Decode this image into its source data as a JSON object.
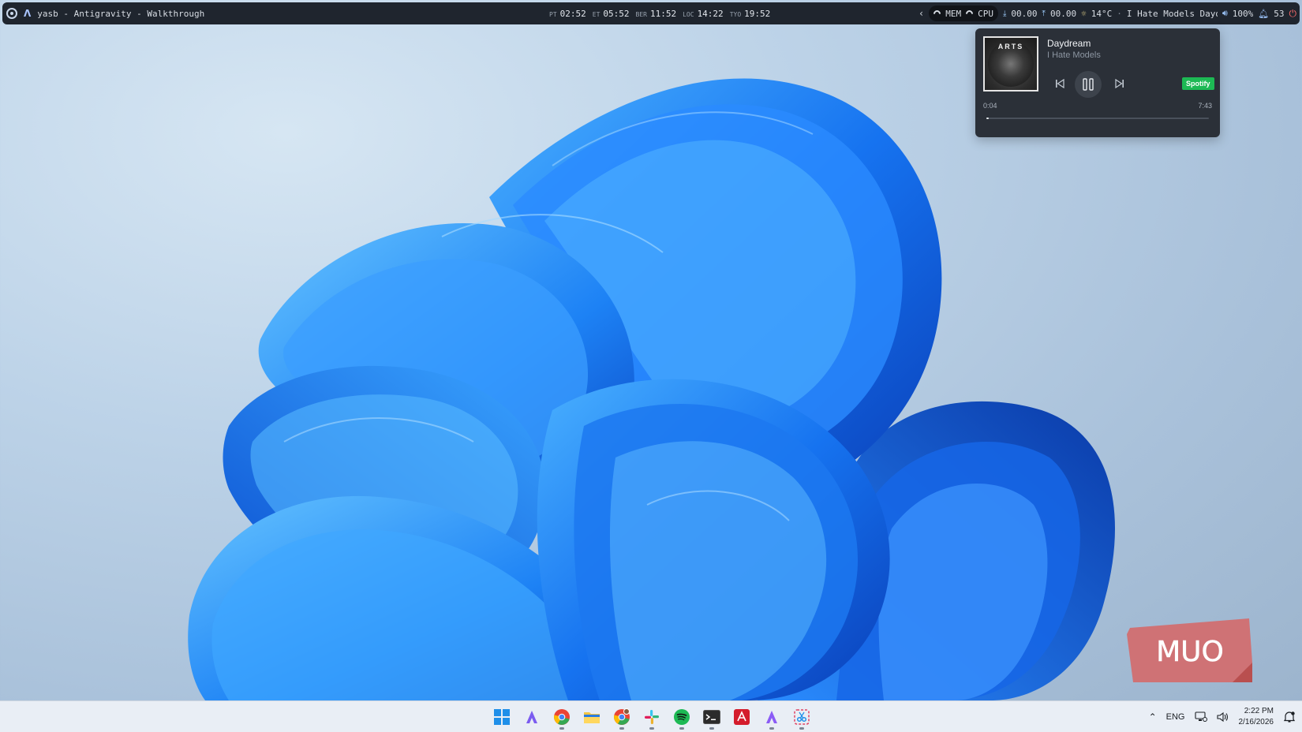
{
  "topbar": {
    "window_title": "yasb - Antigravity - Walkthrough",
    "clocks": [
      {
        "label": "PT",
        "time": "02:52"
      },
      {
        "label": "ET",
        "time": "05:52"
      },
      {
        "label": "BER",
        "time": "11:52"
      },
      {
        "label": "LOC",
        "time": "14:22"
      },
      {
        "label": "TYO",
        "time": "19:52"
      }
    ],
    "mem_label": "MEM",
    "cpu_label": "CPU",
    "download": "00.00",
    "upload": "00.00",
    "weather": "14°C",
    "now_playing": "I Hate Models Daydr",
    "volume": "100%",
    "notifications": "53"
  },
  "media": {
    "album_label": "ARTS",
    "title": "Daydream",
    "artist": "I Hate Models",
    "source_badge": "Spotify",
    "current_time": "0:04",
    "total_time": "7:43",
    "progress_fraction": 0.009
  },
  "watermark": {
    "text": "MUO"
  },
  "taskbar": {
    "apps": [
      "start-button",
      "antigravity",
      "chrome",
      "file-explorer",
      "chrome-profile",
      "slack",
      "spotify",
      "terminal",
      "acrobat",
      "antigravity-2",
      "snipping-tool"
    ],
    "language": "ENG",
    "time": "2:22 PM",
    "date": "2/16/2026"
  },
  "colors": {
    "accent_blue": "#1f8fe9",
    "spotify_green": "#1db954",
    "power_red": "#ff6b6b"
  }
}
